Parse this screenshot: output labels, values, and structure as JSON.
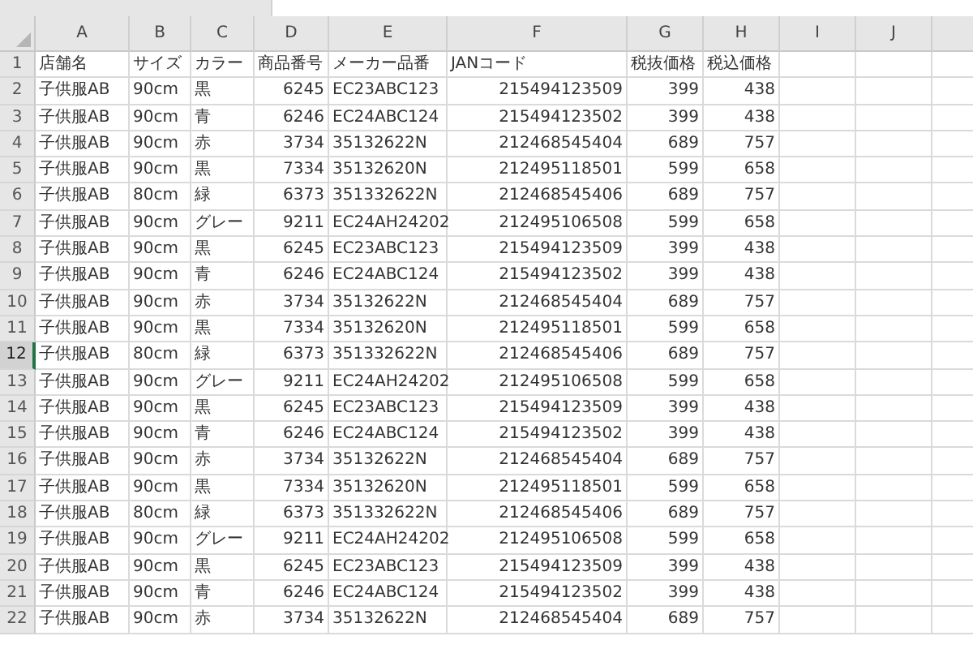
{
  "columns": [
    "A",
    "B",
    "C",
    "D",
    "E",
    "F",
    "G",
    "H",
    "I",
    "J",
    ""
  ],
  "rows": [
    {
      "number": "1",
      "selected": false,
      "cells": [
        "店舗名",
        "サイズ",
        "カラー",
        "商品番号",
        "メーカー品番",
        "JANコード",
        "税抜価格",
        "税込価格"
      ]
    },
    {
      "number": "2",
      "selected": false,
      "cells": [
        "子供服AB",
        "90cm",
        "黒",
        "6245",
        "EC23ABC123",
        "215494123509",
        "399",
        "438"
      ]
    },
    {
      "number": "3",
      "selected": false,
      "cells": [
        "子供服AB",
        "90cm",
        "青",
        "6246",
        "EC24ABC124",
        "215494123502",
        "399",
        "438"
      ]
    },
    {
      "number": "4",
      "selected": false,
      "cells": [
        "子供服AB",
        "90cm",
        "赤",
        "3734",
        "35132622N",
        "212468545404",
        "689",
        "757"
      ]
    },
    {
      "number": "5",
      "selected": false,
      "cells": [
        "子供服AB",
        "90cm",
        "黒",
        "7334",
        "35132620N",
        "212495118501",
        "599",
        "658"
      ]
    },
    {
      "number": "6",
      "selected": false,
      "cells": [
        "子供服AB",
        "80cm",
        "緑",
        "6373",
        "351332622N",
        "212468545406",
        "689",
        "757"
      ]
    },
    {
      "number": "7",
      "selected": false,
      "cells": [
        "子供服AB",
        "90cm",
        "グレー",
        "9211",
        "EC24AH24202",
        "212495106508",
        "599",
        "658"
      ]
    },
    {
      "number": "8",
      "selected": false,
      "cells": [
        "子供服AB",
        "90cm",
        "黒",
        "6245",
        "EC23ABC123",
        "215494123509",
        "399",
        "438"
      ]
    },
    {
      "number": "9",
      "selected": false,
      "cells": [
        "子供服AB",
        "90cm",
        "青",
        "6246",
        "EC24ABC124",
        "215494123502",
        "399",
        "438"
      ]
    },
    {
      "number": "10",
      "selected": false,
      "cells": [
        "子供服AB",
        "90cm",
        "赤",
        "3734",
        "35132622N",
        "212468545404",
        "689",
        "757"
      ]
    },
    {
      "number": "11",
      "selected": false,
      "cells": [
        "子供服AB",
        "90cm",
        "黒",
        "7334",
        "35132620N",
        "212495118501",
        "599",
        "658"
      ]
    },
    {
      "number": "12",
      "selected": true,
      "cells": [
        "子供服AB",
        "80cm",
        "緑",
        "6373",
        "351332622N",
        "212468545406",
        "689",
        "757"
      ]
    },
    {
      "number": "13",
      "selected": false,
      "cells": [
        "子供服AB",
        "90cm",
        "グレー",
        "9211",
        "EC24AH24202",
        "212495106508",
        "599",
        "658"
      ]
    },
    {
      "number": "14",
      "selected": false,
      "cells": [
        "子供服AB",
        "90cm",
        "黒",
        "6245",
        "EC23ABC123",
        "215494123509",
        "399",
        "438"
      ]
    },
    {
      "number": "15",
      "selected": false,
      "cells": [
        "子供服AB",
        "90cm",
        "青",
        "6246",
        "EC24ABC124",
        "215494123502",
        "399",
        "438"
      ]
    },
    {
      "number": "16",
      "selected": false,
      "cells": [
        "子供服AB",
        "90cm",
        "赤",
        "3734",
        "35132622N",
        "212468545404",
        "689",
        "757"
      ]
    },
    {
      "number": "17",
      "selected": false,
      "cells": [
        "子供服AB",
        "90cm",
        "黒",
        "7334",
        "35132620N",
        "212495118501",
        "599",
        "658"
      ]
    },
    {
      "number": "18",
      "selected": false,
      "cells": [
        "子供服AB",
        "80cm",
        "緑",
        "6373",
        "351332622N",
        "212468545406",
        "689",
        "757"
      ]
    },
    {
      "number": "19",
      "selected": false,
      "cells": [
        "子供服AB",
        "90cm",
        "グレー",
        "9211",
        "EC24AH24202",
        "212495106508",
        "599",
        "658"
      ]
    },
    {
      "number": "20",
      "selected": false,
      "cells": [
        "子供服AB",
        "90cm",
        "黒",
        "6245",
        "EC23ABC123",
        "215494123509",
        "399",
        "438"
      ]
    },
    {
      "number": "21",
      "selected": false,
      "cells": [
        "子供服AB",
        "90cm",
        "青",
        "6246",
        "EC24ABC124",
        "215494123502",
        "399",
        "438"
      ]
    },
    {
      "number": "22",
      "selected": false,
      "cells": [
        "子供服AB",
        "90cm",
        "赤",
        "3734",
        "35132622N",
        "212468545404",
        "689",
        "757"
      ]
    }
  ]
}
